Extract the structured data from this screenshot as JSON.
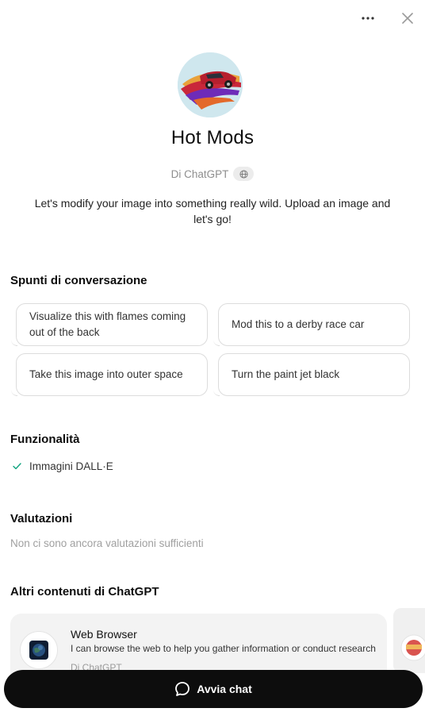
{
  "header": {
    "more_icon": "ellipsis-icon",
    "close_icon": "close-icon"
  },
  "gpt": {
    "name": "Hot Mods",
    "byline": "Di ChatGPT",
    "byline_icon": "globe-icon",
    "description": "Let's modify your image into something really wild. Upload an image and let's go!"
  },
  "starters": {
    "title": "Spunti di conversazione",
    "items": [
      "Visualize this with flames coming out of the back",
      "Mod this to a derby race car",
      "Take this image into outer space",
      "Turn the paint jet black"
    ]
  },
  "features": {
    "title": "Funzionalità",
    "items": [
      {
        "icon": "check-icon",
        "label": "Immagini DALL·E"
      }
    ]
  },
  "ratings": {
    "title": "Valutazioni",
    "empty_text": "Non ci sono ancora valutazioni sufficienti"
  },
  "more_content": {
    "title": "Altri contenuti di ChatGPT",
    "cards": [
      {
        "title": "Web Browser",
        "description": "I can browse the web to help you gather information or conduct research",
        "byline": "Di ChatGPT",
        "icon": "earth-icon"
      }
    ]
  },
  "cta": {
    "label": "Avvia chat",
    "icon": "chat-bubble-icon"
  },
  "colors": {
    "cta_background": "#0d0d0d",
    "check": "#10a37f"
  }
}
